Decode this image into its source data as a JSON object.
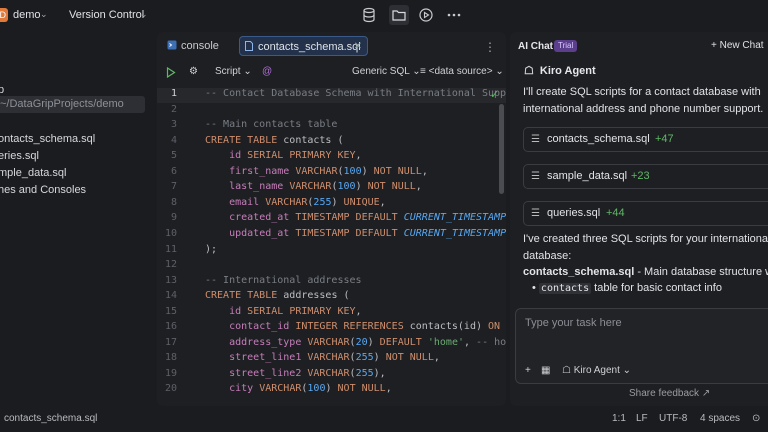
{
  "topbar": {
    "project_badge": "D",
    "project_name": "demo",
    "version_control": "Version Control",
    "icons": [
      "database-icon",
      "folder-icon",
      "run-icon",
      "more-icon"
    ]
  },
  "project_tree": {
    "items": [
      {
        "label": "p"
      },
      {
        "label": "~/DataGripProjects/demo"
      },
      {
        "label": "ontacts_schema.sql"
      },
      {
        "label": "eries.sql"
      },
      {
        "label": "mple_data.sql"
      },
      {
        "label": "hes and Consoles"
      }
    ]
  },
  "editor": {
    "tabs": [
      {
        "label": "console"
      },
      {
        "label": "contacts_schema.sql"
      }
    ],
    "toolbar": {
      "script": "Script",
      "dialect": "Generic SQL",
      "datasource": "<data source>"
    },
    "lines": [
      {
        "n": "1",
        "html": "<span class='c'>-- Contact Database Schema with International Suppo</span>"
      },
      {
        "n": "2",
        "html": ""
      },
      {
        "n": "3",
        "html": "<span class='c'>-- Main contacts table</span>"
      },
      {
        "n": "4",
        "html": "<span class='k'>CREATE TABLE</span> <span class='p'>contacts (</span>"
      },
      {
        "n": "5",
        "html": "    <span class='fld'>id</span> <span class='k'>SERIAL PRIMARY KEY</span><span class='p'>,</span>"
      },
      {
        "n": "6",
        "html": "    <span class='fld'>first_name</span> <span class='k'>VARCHAR</span><span class='p'>(</span><span class='f' style='font-style:normal'>100</span><span class='p'>)</span> <span class='k'>NOT NULL</span><span class='p'>,</span>"
      },
      {
        "n": "7",
        "html": "    <span class='fld'>last_name</span> <span class='k'>VARCHAR</span><span class='p'>(</span><span class='f' style='font-style:normal'>100</span><span class='p'>)</span> <span class='k'>NOT NULL</span><span class='p'>,</span>"
      },
      {
        "n": "8",
        "html": "    <span class='fld'>email</span> <span class='k'>VARCHAR</span><span class='p'>(</span><span class='f' style='font-style:normal'>255</span><span class='p'>)</span> <span class='k'>UNIQUE</span><span class='p'>,</span>"
      },
      {
        "n": "9",
        "html": "    <span class='fld'>created_at</span> <span class='k'>TIMESTAMP DEFAULT</span> <span class='f'>CURRENT_TIMESTAMP</span><span class='p'>,</span>"
      },
      {
        "n": "10",
        "html": "    <span class='fld'>updated_at</span> <span class='k'>TIMESTAMP DEFAULT</span> <span class='f'>CURRENT_TIMESTAMP</span>"
      },
      {
        "n": "11",
        "html": "<span class='p'>);</span>"
      },
      {
        "n": "12",
        "html": ""
      },
      {
        "n": "13",
        "html": "<span class='c'>-- International addresses</span>"
      },
      {
        "n": "14",
        "html": "<span class='k'>CREATE TABLE</span> <span class='p'>addresses (</span>"
      },
      {
        "n": "15",
        "html": "    <span class='fld'>id</span> <span class='k'>SERIAL PRIMARY KEY</span><span class='p'>,</span>"
      },
      {
        "n": "16",
        "html": "    <span class='fld'>contact_id</span> <span class='k'>INTEGER REFERENCES</span> <span class='p'>contacts(id)</span> <span class='k'>ON DELE</span>"
      },
      {
        "n": "17",
        "html": "    <span class='fld'>address_type</span> <span class='k'>VARCHAR</span><span class='p'>(</span><span class='f' style='font-style:normal'>20</span><span class='p'>)</span> <span class='k'>DEFAULT</span> <span class='s'>'home'</span><span class='p'>,</span> <span class='c'>-- home,</span>"
      },
      {
        "n": "18",
        "html": "    <span class='fld'>street_line1</span> <span class='k'>VARCHAR</span><span class='p'>(</span><span class='f' style='font-style:normal'>255</span><span class='p'>)</span> <span class='k'>NOT NULL</span><span class='p'>,</span>"
      },
      {
        "n": "19",
        "html": "    <span class='fld'>street_line2</span> <span class='k'>VARCHAR</span><span class='p'>(</span><span class='f' style='font-style:normal'>255</span><span class='p'>),</span>"
      },
      {
        "n": "20",
        "html": "    <span class='fld'>city</span> <span class='k'>VARCHAR</span><span class='p'>(</span><span class='f' style='font-style:normal'>100</span><span class='p'>)</span> <span class='k'>NOT NULL</span><span class='p'>,</span>"
      }
    ]
  },
  "chat": {
    "title": "AI Chat",
    "badge": "Trial",
    "new_chat": "New Chat",
    "agent_name": "Kiro Agent",
    "intro_line1": "I'll create SQL scripts for a contact database with",
    "intro_line2": "international address and phone number support.",
    "files": [
      {
        "name": "contacts_schema.sql",
        "delta": "+47"
      },
      {
        "name": "sample_data.sql",
        "delta": "+23"
      },
      {
        "name": "queries.sql",
        "delta": "+44"
      }
    ],
    "summary_line1": "I've created three SQL scripts for your internationa",
    "summary_line2": "database:",
    "summary_bold": "contacts_schema.sql",
    "summary_rest": " - Main database structure wi",
    "bullet_code": "contacts",
    "bullet_rest": " table for basic contact info",
    "input_placeholder": "Type your task here",
    "agent_select": "Kiro Agent",
    "share_feedback": "Share feedback ↗"
  },
  "statusbar": {
    "file": "contacts_schema.sql",
    "position": "1:1",
    "line_ending": "LF",
    "encoding": "UTF-8",
    "indent": "4 spaces"
  },
  "colors": {
    "background": "#1b1c1f",
    "editor_bg": "#1e1f22",
    "keyword": "#cf8e6d",
    "comment": "#7a7e85",
    "function": "#56a8f5",
    "string": "#6aab73",
    "added": "#5fb865",
    "trial_badge": "#5b3f8c"
  }
}
